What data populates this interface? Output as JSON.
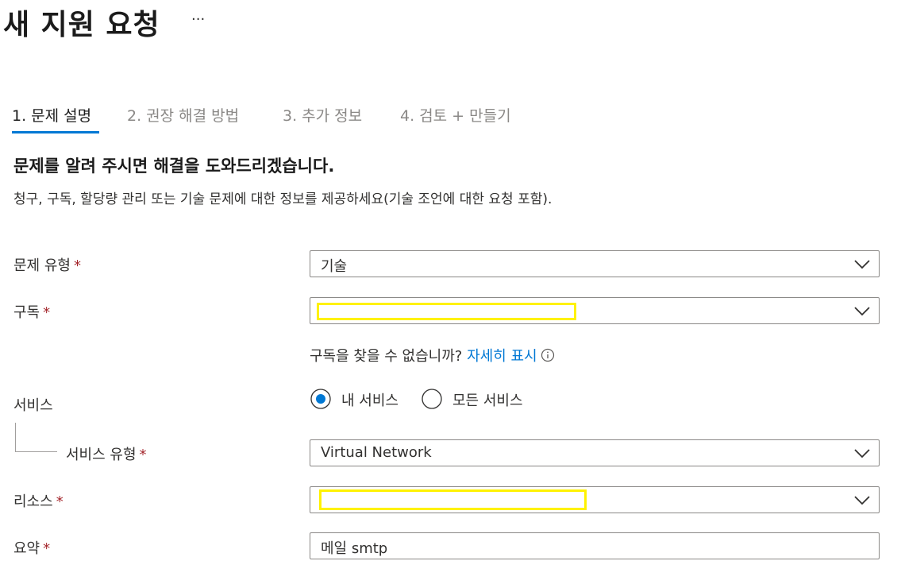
{
  "header": {
    "title": "새 지원 요청",
    "more_label": "..."
  },
  "tabs": [
    {
      "label": "1. 문제 설명",
      "active": true
    },
    {
      "label": "2. 권장 해결 방법",
      "active": false
    },
    {
      "label": "3. 추가 정보",
      "active": false
    },
    {
      "label": "4. 검토 + 만들기",
      "active": false
    }
  ],
  "section": {
    "heading": "문제를 알려 주시면 해결을 도와드리겠습니다.",
    "description": "청구, 구독, 할당량 관리 또는 기술 문제에 대한 정보를 제공하세요(기술 조언에 대한 요청 포함)."
  },
  "form": {
    "issue_type": {
      "label": "문제 유형",
      "required_mark": "*",
      "value": "기술"
    },
    "subscription": {
      "label": "구독",
      "required_mark": "*",
      "value": ""
    },
    "subscription_hint": {
      "text": "구독을 찾을 수 없습니까?",
      "link": "자세히 표시"
    },
    "service": {
      "label": "서비스",
      "option_mine": "내 서비스",
      "option_all": "모든 서비스",
      "selected": "내 서비스"
    },
    "service_type": {
      "label": "서비스 유형",
      "required_mark": "*",
      "value": "Virtual Network"
    },
    "resource": {
      "label": "리소스",
      "required_mark": "*",
      "value": ""
    },
    "summary": {
      "label": "요약",
      "required_mark": "*",
      "value": "메일 smtp"
    }
  },
  "colors": {
    "accent": "#0078d4",
    "required": "#a4262c",
    "redaction": "#fff200"
  }
}
